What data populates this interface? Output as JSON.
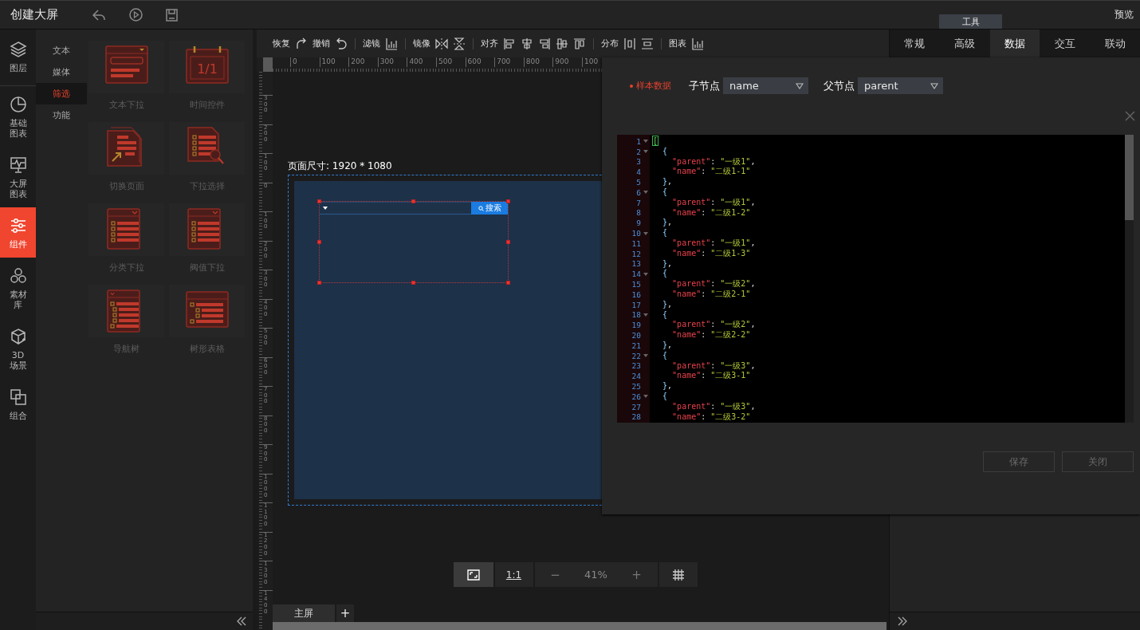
{
  "header": {
    "title": "创建大屏",
    "tool_tab": "工具",
    "preview": "预览"
  },
  "nav": [
    {
      "lines": [
        "图层"
      ],
      "kind": "layers",
      "selected": false
    },
    {
      "lines": [
        "基础",
        "图表"
      ],
      "kind": "pie",
      "selected": false
    },
    {
      "lines": [
        "大屏",
        "图表"
      ],
      "kind": "monitor",
      "selected": false
    },
    {
      "lines": [
        "组件"
      ],
      "kind": "sliders",
      "selected": true
    },
    {
      "lines": [
        "素材",
        "库"
      ],
      "kind": "circles",
      "selected": false
    },
    {
      "lines": [
        "3D",
        "场景"
      ],
      "kind": "cube",
      "selected": false
    },
    {
      "lines": [
        "组合"
      ],
      "kind": "combine",
      "selected": false
    }
  ],
  "categories": [
    {
      "label": "文本",
      "selected": false
    },
    {
      "label": "媒体",
      "selected": false
    },
    {
      "label": "筛选",
      "selected": true
    },
    {
      "label": "功能",
      "selected": false
    }
  ],
  "component_rows": [
    [
      {
        "label": "文本下拉",
        "kind": "text-dropdown"
      },
      {
        "label": "时间控件",
        "kind": "calendar",
        "icon_text": "1/1"
      }
    ],
    [
      {
        "label": "切换页面",
        "kind": "page-switch"
      },
      {
        "label": "下拉选择",
        "kind": "select-search"
      }
    ],
    [
      {
        "label": "分类下拉",
        "kind": "list-dropdown"
      },
      {
        "label": "阀值下拉",
        "kind": "list-dropdown"
      }
    ],
    [
      {
        "label": "导航树",
        "kind": "tree"
      },
      {
        "label": "树形表格",
        "kind": "tree-table"
      }
    ]
  ],
  "toolbar": [
    [
      {
        "kind": "label",
        "text": "恢复"
      },
      {
        "kind": "redo"
      },
      {
        "kind": "label",
        "text": "撤销"
      },
      {
        "kind": "undo"
      }
    ],
    [
      {
        "kind": "label",
        "text": "滤镜"
      },
      {
        "kind": "chart"
      }
    ],
    [
      {
        "kind": "label",
        "text": "镜像"
      },
      {
        "kind": "flip-h"
      },
      {
        "kind": "flip-v"
      }
    ],
    [
      {
        "kind": "label",
        "text": "对齐"
      },
      {
        "kind": "align-left"
      },
      {
        "kind": "align-center"
      },
      {
        "kind": "align-right"
      },
      {
        "kind": "align-middle"
      },
      {
        "kind": "align-top"
      }
    ],
    [
      {
        "kind": "label",
        "text": "分布"
      },
      {
        "kind": "dist-h"
      },
      {
        "kind": "dist-v"
      }
    ],
    [
      {
        "kind": "label",
        "text": "图表"
      },
      {
        "kind": "chart"
      }
    ]
  ],
  "ruler": {
    "horizontal": [
      "0",
      "100",
      "200",
      "300",
      "400",
      "500",
      "600",
      "700",
      "800",
      "900",
      "100"
    ],
    "vertical": [
      "300",
      "200",
      "100",
      "0",
      "100",
      "200",
      "300",
      "400",
      "500",
      "600",
      "700",
      "800",
      "900",
      "1000",
      "1100",
      "1200",
      "1300",
      "1400"
    ]
  },
  "canvas": {
    "page_size": "页面尺寸: 1920 * 1080",
    "widget": {
      "selected": true,
      "button": "搜索"
    }
  },
  "zoom": [
    {
      "kind": "fit",
      "selected": true
    },
    {
      "kind": "text",
      "text": "1:1",
      "selected": false
    },
    {
      "kind": "minus",
      "text": "−"
    },
    {
      "kind": "value",
      "text": "41%"
    },
    {
      "kind": "plus",
      "text": "+"
    },
    {
      "kind": "grid"
    }
  ],
  "screens": {
    "tabs": [
      {
        "label": "主屏",
        "selected": true
      }
    ],
    "add": "+"
  },
  "props_tabs": [
    {
      "label": "常规",
      "selected": false
    },
    {
      "label": "高级",
      "selected": false
    },
    {
      "label": "数据",
      "selected": true
    },
    {
      "label": "交互",
      "selected": false
    },
    {
      "label": "联动",
      "selected": false
    }
  ],
  "dialog": {
    "sample_label": "样本数据",
    "child_label": "子节点",
    "child_value": "name",
    "parent_label": "父节点",
    "parent_value": "parent",
    "lines": [
      {
        "no": "1",
        "fold": true,
        "text": "[",
        "match": true
      },
      {
        "no": "2",
        "fold": true,
        "text": "  {"
      },
      {
        "no": "3",
        "fold": false,
        "text": "    \"parent\": \"一级1\","
      },
      {
        "no": "4",
        "fold": false,
        "text": "    \"name\": \"二级1-1\""
      },
      {
        "no": "5",
        "fold": false,
        "text": "  },"
      },
      {
        "no": "6",
        "fold": true,
        "text": "  {"
      },
      {
        "no": "7",
        "fold": false,
        "text": "    \"parent\": \"一级1\","
      },
      {
        "no": "8",
        "fold": false,
        "text": "    \"name\": \"二级1-2\""
      },
      {
        "no": "9",
        "fold": false,
        "text": "  },"
      },
      {
        "no": "10",
        "fold": true,
        "text": "  {"
      },
      {
        "no": "11",
        "fold": false,
        "text": "    \"parent\": \"一级1\","
      },
      {
        "no": "12",
        "fold": false,
        "text": "    \"name\": \"二级1-3\""
      },
      {
        "no": "13",
        "fold": false,
        "text": "  },"
      },
      {
        "no": "14",
        "fold": true,
        "text": "  {"
      },
      {
        "no": "15",
        "fold": false,
        "text": "    \"parent\": \"一级2\","
      },
      {
        "no": "16",
        "fold": false,
        "text": "    \"name\": \"二级2-1\""
      },
      {
        "no": "17",
        "fold": false,
        "text": "  },"
      },
      {
        "no": "18",
        "fold": true,
        "text": "  {"
      },
      {
        "no": "19",
        "fold": false,
        "text": "    \"parent\": \"一级2\","
      },
      {
        "no": "20",
        "fold": false,
        "text": "    \"name\": \"二级2-2\""
      },
      {
        "no": "21",
        "fold": false,
        "text": "  },"
      },
      {
        "no": "22",
        "fold": true,
        "text": "  {"
      },
      {
        "no": "23",
        "fold": false,
        "text": "    \"parent\": \"一级3\","
      },
      {
        "no": "24",
        "fold": false,
        "text": "    \"name\": \"二级3-1\""
      },
      {
        "no": "25",
        "fold": false,
        "text": "  },"
      },
      {
        "no": "26",
        "fold": true,
        "text": "  {"
      },
      {
        "no": "27",
        "fold": false,
        "text": "    \"parent\": \"一级3\","
      },
      {
        "no": "28",
        "fold": false,
        "text": "    \"name\": \"二级3-2\""
      }
    ],
    "buttons": [
      {
        "label": "保存",
        "disabled": true
      },
      {
        "label": "关闭",
        "disabled": true
      }
    ]
  }
}
